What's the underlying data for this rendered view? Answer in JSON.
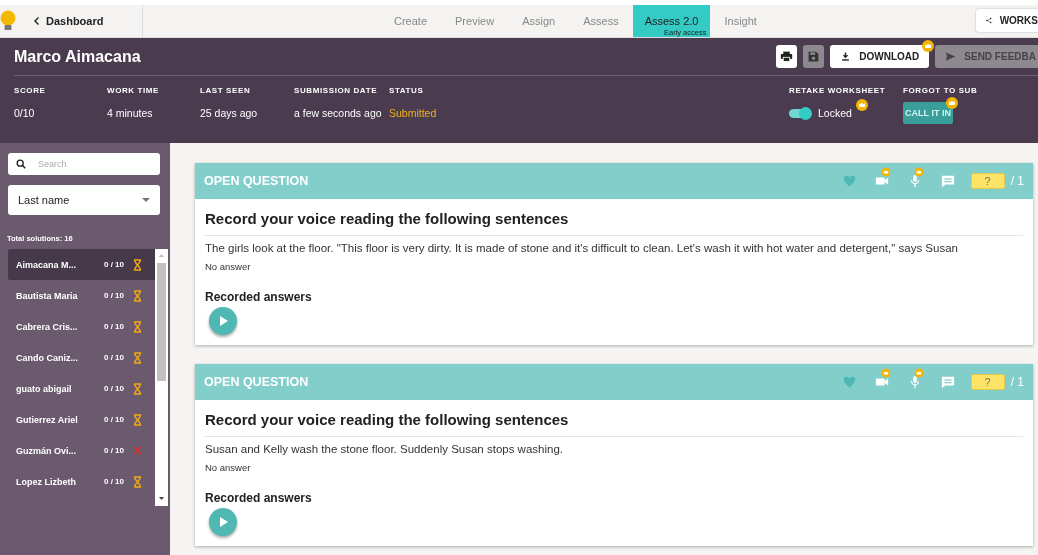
{
  "app": {
    "back_link": "Dashboard",
    "tabs": [
      {
        "label": "Create",
        "selected": false
      },
      {
        "label": "Preview",
        "selected": false
      },
      {
        "label": "Assign",
        "selected": false
      },
      {
        "label": "Assess",
        "selected": false
      },
      {
        "label": "Assess 2.0",
        "badge": "Early access",
        "selected": true
      },
      {
        "label": "Insight",
        "selected": false
      }
    ],
    "share_button": "WORKS"
  },
  "student": {
    "name": "Marco Aimacana",
    "actions": [
      {
        "kind": "print"
      },
      {
        "kind": "save"
      },
      {
        "kind": "download",
        "label": "DOWNLOAD",
        "premium": true
      },
      {
        "kind": "send",
        "label": "SEND FEEDBA"
      }
    ],
    "stats": [
      {
        "label": "SCORE",
        "value": "0/10",
        "kind": "plain"
      },
      {
        "label": "WORK TIME",
        "value": "4 minutes",
        "kind": "plain"
      },
      {
        "label": "LAST SEEN",
        "value": "25 days ago",
        "kind": "plain"
      },
      {
        "label": "SUBMISSION DATE",
        "value": "a few seconds ago",
        "kind": "plain"
      },
      {
        "label": "STATUS",
        "value": "Submitted",
        "kind": "status"
      }
    ],
    "retake": {
      "label": "RETAKE WORKSHEET",
      "on": true,
      "state": "Locked",
      "premium": true
    },
    "forgot": {
      "label": "FORGOT TO SUB",
      "button": "CALL IT IN",
      "disabled": true,
      "premium": true
    }
  },
  "sidebar": {
    "search_placeholder": "Search",
    "sort": "Last name",
    "total": "Total solutions: 16",
    "students": [
      {
        "name": "Aimacana M...",
        "score": "0 / 10",
        "kind": "pending",
        "selected": true
      },
      {
        "name": "Bautista Maria",
        "score": "0 / 10",
        "kind": "pending",
        "selected": false
      },
      {
        "name": "Cabrera Cris...",
        "score": "0 / 10",
        "kind": "pending",
        "selected": false
      },
      {
        "name": "Cando Caniz...",
        "score": "0 / 10",
        "kind": "pending",
        "selected": false
      },
      {
        "name": "guato abigail",
        "score": "0 / 10",
        "kind": "pending",
        "selected": false
      },
      {
        "name": "Gutierrez Ariel",
        "score": "0 / 10",
        "kind": "pending",
        "selected": false
      },
      {
        "name": "Guzmán Ovi...",
        "score": "0 / 10",
        "kind": "failed",
        "selected": false
      },
      {
        "name": "Lopez Lizbeth",
        "score": "0 / 10",
        "kind": "pending",
        "selected": false
      }
    ]
  },
  "questions": [
    {
      "type": "OPEN QUESTION",
      "tools": [
        {
          "kind": "heart"
        },
        {
          "kind": "video",
          "premium": true
        },
        {
          "kind": "mic",
          "premium": true
        },
        {
          "kind": "comment"
        }
      ],
      "points": "?",
      "max": "/ 1",
      "title": "Record your voice reading the following sentences",
      "text": "The girls look at the floor. \"This floor is very dirty. It is made of stone and it's difficult to clean. Let's wash it with hot water and detergent,\" says Susan",
      "answer": "No answer",
      "recorded_label": "Recorded answers"
    },
    {
      "type": "OPEN QUESTION",
      "tools": [
        {
          "kind": "heart"
        },
        {
          "kind": "video",
          "premium": true
        },
        {
          "kind": "mic",
          "premium": true
        },
        {
          "kind": "comment"
        }
      ],
      "points": "?",
      "max": "/ 1",
      "title": "Record your voice reading the following sentences",
      "text": "Susan and Kelly wash the stone floor. Suddenly Susan stops washing.",
      "answer": "No answer",
      "recorded_label": "Recorded answers"
    }
  ]
}
